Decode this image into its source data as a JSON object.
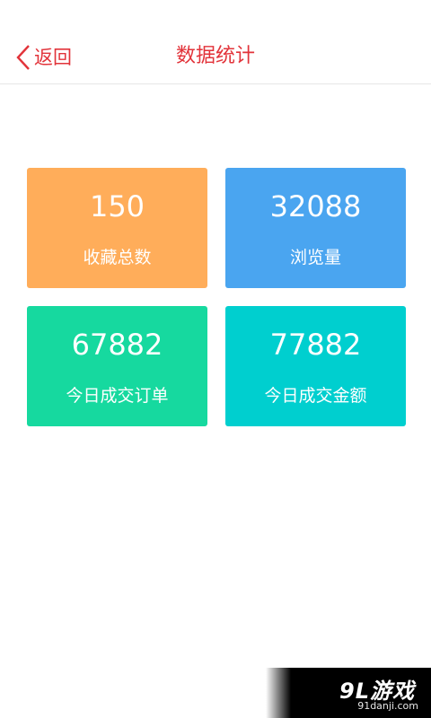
{
  "header": {
    "back_label": "返回",
    "title": "数据统计"
  },
  "colors": {
    "accent": "#e2333a",
    "card_orange": "#ffad5a",
    "card_blue": "#4aa5f0",
    "card_green": "#16d99f",
    "card_teal": "#00cfcf"
  },
  "stats": [
    {
      "value": "150",
      "label": "收藏总数"
    },
    {
      "value": "32088",
      "label": "浏览量"
    },
    {
      "value": "67882",
      "label": "今日成交订单"
    },
    {
      "value": "77882",
      "label": "今日成交金额"
    }
  ],
  "watermark": {
    "logo": "9L游戏",
    "url": "91danji.com"
  }
}
